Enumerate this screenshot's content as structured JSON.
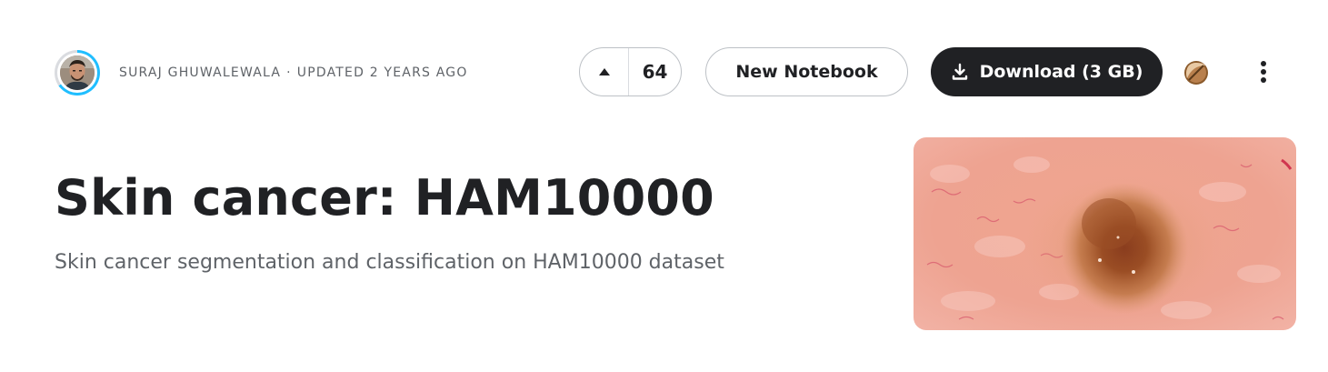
{
  "header": {
    "author": "SURAJ GHUWALEWALA",
    "separator": "·",
    "updated": "UPDATED 2 YEARS AGO"
  },
  "vote": {
    "count": "64",
    "icon": "upvote-triangle-icon"
  },
  "actions": {
    "new_notebook_label": "New Notebook",
    "download_label": "Download (3 GB)",
    "download_icon": "download-icon",
    "bullet_icon": "bullet-icon",
    "more_icon": "more-vert-icon"
  },
  "dataset": {
    "title": "Skin cancer: HAM10000",
    "subtitle": "Skin cancer segmentation and classification on HAM10000 dataset"
  },
  "colors": {
    "primary_dark": "#202124",
    "avatar_ring": "#20beff",
    "muted_text": "#5f6368",
    "border": "#bdc1c6"
  }
}
